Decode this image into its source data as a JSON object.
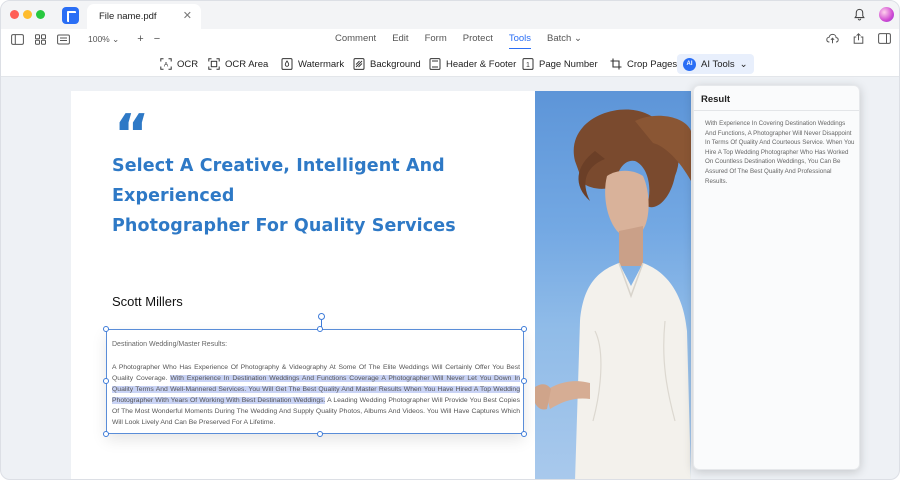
{
  "window": {
    "file_tab": {
      "name": "File name.pdf",
      "close_glyph": "✕"
    },
    "colors": {
      "accent": "#2a6ef5",
      "heading": "#2e79c6",
      "highlight": "#c9d3f5"
    }
  },
  "menubar": {
    "zoom": "100%",
    "zoom_chevron": "⌄",
    "zoom_in": "+",
    "zoom_out": "−",
    "tabs": [
      {
        "label": "Comment"
      },
      {
        "label": "Edit"
      },
      {
        "label": "Form"
      },
      {
        "label": "Protect"
      },
      {
        "label": "Tools",
        "active": true
      },
      {
        "label": "Batch",
        "chevron": "⌄"
      }
    ]
  },
  "toolbar": {
    "items": [
      {
        "label": "OCR",
        "icon": "ocr-icon"
      },
      {
        "label": "OCR Area",
        "icon": "ocr-area-icon"
      },
      {
        "label": "Watermark",
        "icon": "watermark-icon"
      },
      {
        "label": "Background",
        "icon": "background-icon"
      },
      {
        "label": "Header & Footer",
        "icon": "header-footer-icon"
      },
      {
        "label": "Page Number",
        "icon": "page-number-icon",
        "glyph": "1"
      },
      {
        "label": "Crop Pages",
        "icon": "crop-icon"
      },
      {
        "label": "AI Tools",
        "icon": "ai-icon",
        "badge": "AI",
        "chevron": "⌄"
      }
    ]
  },
  "document": {
    "quote_mark": "“",
    "heading_line1": "Select A Creative, Intelligent And Experienced",
    "heading_line2": "Photographer For Quality Services",
    "author": "Scott Millers",
    "textbox": {
      "title": "Destination Wedding/Master Results:",
      "body_before": "A Photographer Who Has Experience Of Photography & Videography At Some Of The Elite Weddings Will Certainly Offer You Best Quality Coverage. ",
      "body_highlight": "With Experience In Destination Weddings And Functions Coverage A Photographer Will Never Let You Down In Quality Terms And Well-Mannered Services. You Will Get The Best Quality And Master Results When You Have Hired A Top Wedding Photographer With Years Of Working With Best Destination Weddings.",
      "body_after": " A Leading Wedding Photographer Will Provide You Best Copies Of The Most Wonderful Moments During The Wedding And Supply Quality Photos, Albums And Videos. You Will Have Captures Which Will Look Lively And Can Be Preserved For A Lifetime."
    }
  },
  "result_panel": {
    "title": "Result",
    "text": "With Experience In Covering Destination Weddings And Functions, A Photographer Will Never Disappoint In Terms Of Quality And Courteous Service. When You Hire A Top Wedding Photographer Who Has Worked On Countless Destination Weddings, You Can Be Assured Of The Best Quality And Professional Results."
  }
}
